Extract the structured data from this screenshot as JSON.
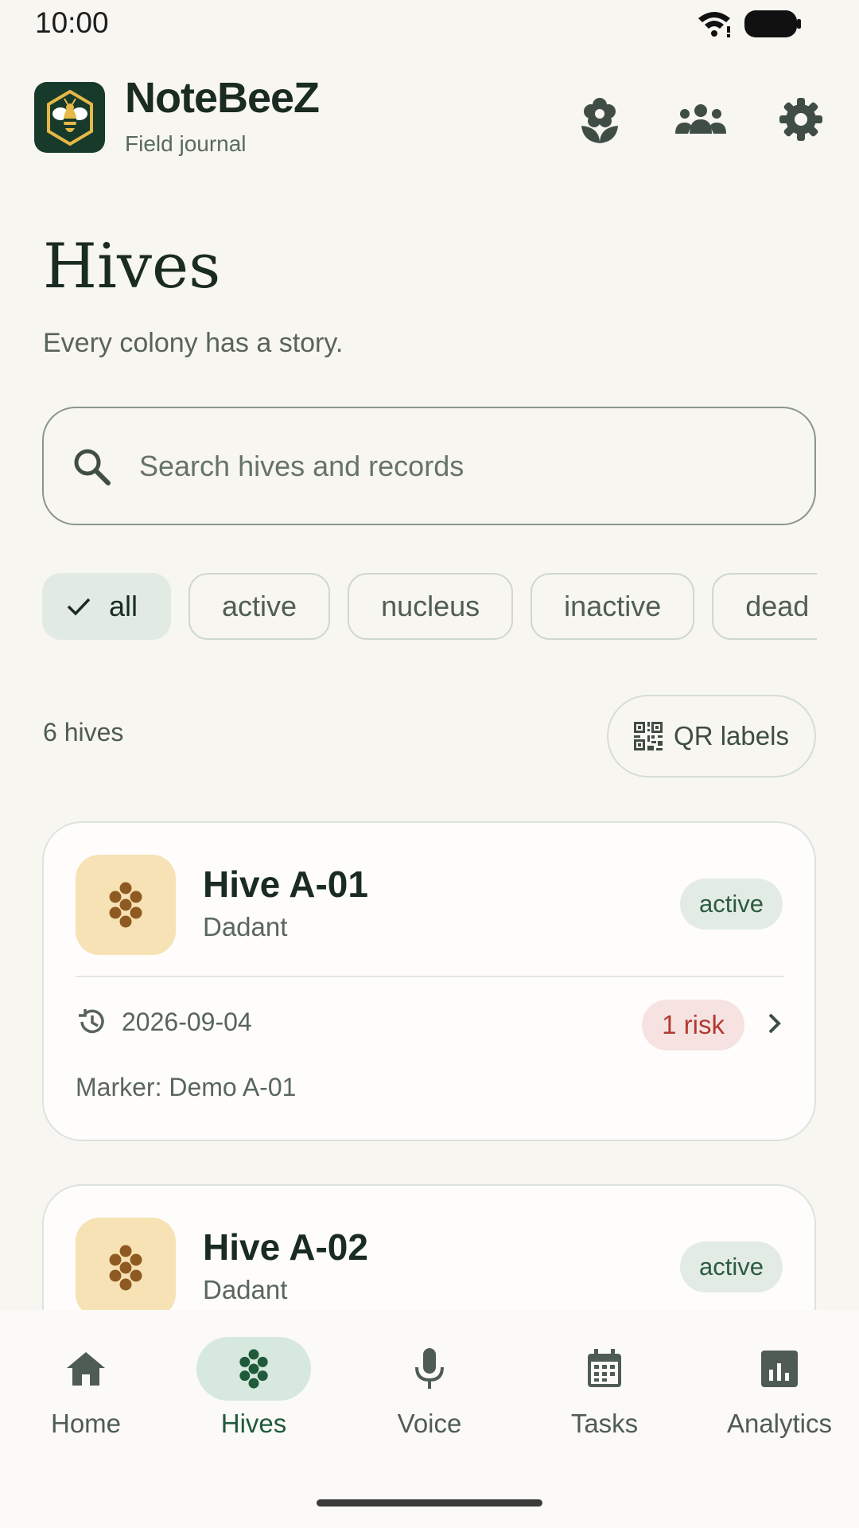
{
  "status_bar": {
    "time": "10:00"
  },
  "header": {
    "app_name": "NoteBeeZ",
    "app_subtitle": "Field journal",
    "icons": [
      "flower-icon",
      "group-icon",
      "gear-icon"
    ]
  },
  "page": {
    "title": "Hives",
    "subtitle": "Every colony has a story."
  },
  "search": {
    "placeholder": "Search hives and records",
    "value": ""
  },
  "filters": [
    {
      "label": "all",
      "selected": true
    },
    {
      "label": "active",
      "selected": false
    },
    {
      "label": "nucleus",
      "selected": false
    },
    {
      "label": "inactive",
      "selected": false
    },
    {
      "label": "dead",
      "selected": false
    }
  ],
  "list": {
    "count_label": "6 hives",
    "qr_button_label": "QR labels"
  },
  "hives": [
    {
      "name": "Hive A-01",
      "type": "Dadant",
      "status": "active",
      "date": "2026-09-04",
      "risk": "1 risk",
      "marker": "Marker: Demo A-01"
    },
    {
      "name": "Hive A-02",
      "type": "Dadant",
      "status": "active"
    }
  ],
  "bottom_nav": [
    {
      "label": "Home",
      "icon": "home-icon",
      "active": false
    },
    {
      "label": "Hives",
      "icon": "honeycomb-icon",
      "active": true
    },
    {
      "label": "Voice",
      "icon": "microphone-icon",
      "active": false
    },
    {
      "label": "Tasks",
      "icon": "calendar-icon",
      "active": false
    },
    {
      "label": "Analytics",
      "icon": "bar-chart-icon",
      "active": false
    }
  ],
  "colors": {
    "background": "#f8f6f1",
    "primary_dark": "#183a2b",
    "honey": "#f6e2b4",
    "risk": "#b23a32"
  }
}
